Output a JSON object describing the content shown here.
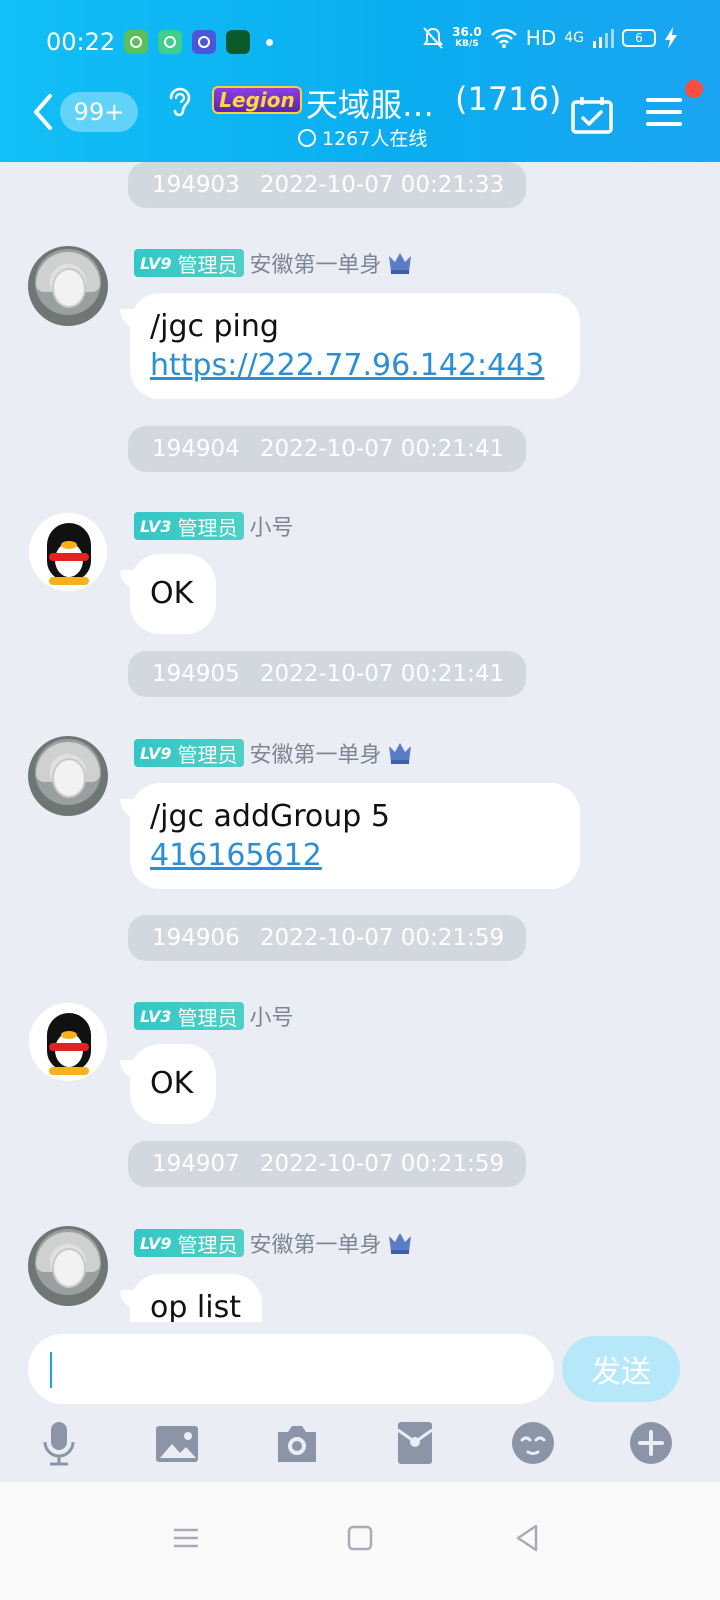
{
  "status_bar": {
    "time": "00:22",
    "net_speed_value": "36.0",
    "net_speed_unit": "KB/S",
    "hd": "HD",
    "signal": "4G",
    "battery": "6"
  },
  "header": {
    "unread_badge": "99+",
    "legion_logo": "Legion",
    "title": "天域服…",
    "member_count": "(1716)",
    "online": "1267人在线"
  },
  "messages": [
    {
      "type": "stamp",
      "id": "194903",
      "datetime": "2022-10-07 00:21:33"
    },
    {
      "type": "msg",
      "level": "LV9",
      "role": "管理员",
      "name": "安徽第一单身",
      "avatar": "anime-girl-avatar",
      "text": "/jgc ping",
      "link": "https://222.77.96.142:443"
    },
    {
      "type": "stamp",
      "id": "194904",
      "datetime": "2022-10-07 00:21:41"
    },
    {
      "type": "msg",
      "level": "LV3",
      "role": "管理员",
      "name": "小号",
      "avatar": "penguin-avatar",
      "text": "OK"
    },
    {
      "type": "stamp",
      "id": "194905",
      "datetime": "2022-10-07 00:21:41"
    },
    {
      "type": "msg",
      "level": "LV9",
      "role": "管理员",
      "name": "安徽第一单身",
      "avatar": "anime-girl-avatar",
      "text": "/jgc addGroup 5",
      "link": "416165612"
    },
    {
      "type": "stamp",
      "id": "194906",
      "datetime": "2022-10-07 00:21:59"
    },
    {
      "type": "msg",
      "level": "LV3",
      "role": "管理员",
      "name": "小号",
      "avatar": "penguin-avatar",
      "text": "OK"
    },
    {
      "type": "stamp",
      "id": "194907",
      "datetime": "2022-10-07 00:21:59"
    },
    {
      "type": "msg",
      "level": "LV9",
      "role": "管理员",
      "name": "安徽第一单身",
      "avatar": "anime-girl-avatar",
      "text": "op list"
    }
  ],
  "input": {
    "value": "",
    "send_label": "发送"
  },
  "toolbar_icons": [
    "microphone-icon",
    "image-icon",
    "camera-icon",
    "red-packet-icon",
    "emoji-icon",
    "plus-icon"
  ],
  "colors": {
    "header": "#0aaef0",
    "admin_tag": "#32c7c7",
    "link": "#2a8fd6",
    "send_disabled": "#b6e8fa"
  }
}
